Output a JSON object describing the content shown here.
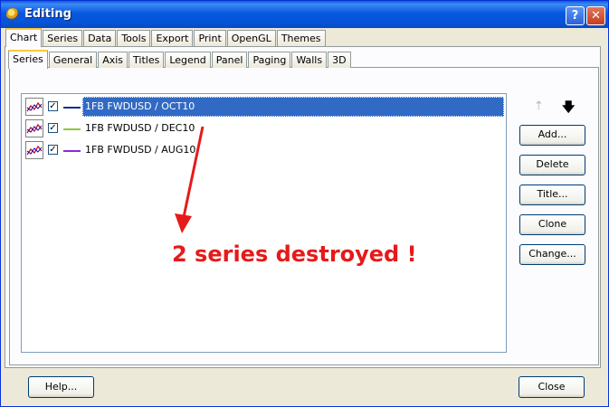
{
  "window": {
    "title": "Editing",
    "help_symbol": "?",
    "close_symbol": "✕"
  },
  "top_tabs": [
    "Chart",
    "Series",
    "Data",
    "Tools",
    "Export",
    "Print",
    "OpenGL",
    "Themes"
  ],
  "inner_tabs": [
    "Series",
    "General",
    "Axis",
    "Titles",
    "Legend",
    "Panel",
    "Paging",
    "Walls",
    "3D"
  ],
  "series_list": [
    {
      "label": "1FB FWDUSD / OCT10",
      "checked": "✓",
      "color": "#1a2a9a",
      "selected": true
    },
    {
      "label": "1FB FWDUSD / DEC10",
      "checked": "✓",
      "color": "#8cc83c",
      "selected": false
    },
    {
      "label": "1FB FWDUSD / AUG10",
      "checked": "✓",
      "color": "#8a2be2",
      "selected": false
    }
  ],
  "side_buttons": [
    "Add...",
    "Delete",
    "Title...",
    "Clone",
    "Change..."
  ],
  "move_arrows": {
    "up": "⇡",
    "down": "🡇"
  },
  "annotation": {
    "text": "2 series destroyed !",
    "color": "#e61a1a"
  },
  "bottom_buttons": {
    "help": "Help...",
    "close": "Close"
  }
}
